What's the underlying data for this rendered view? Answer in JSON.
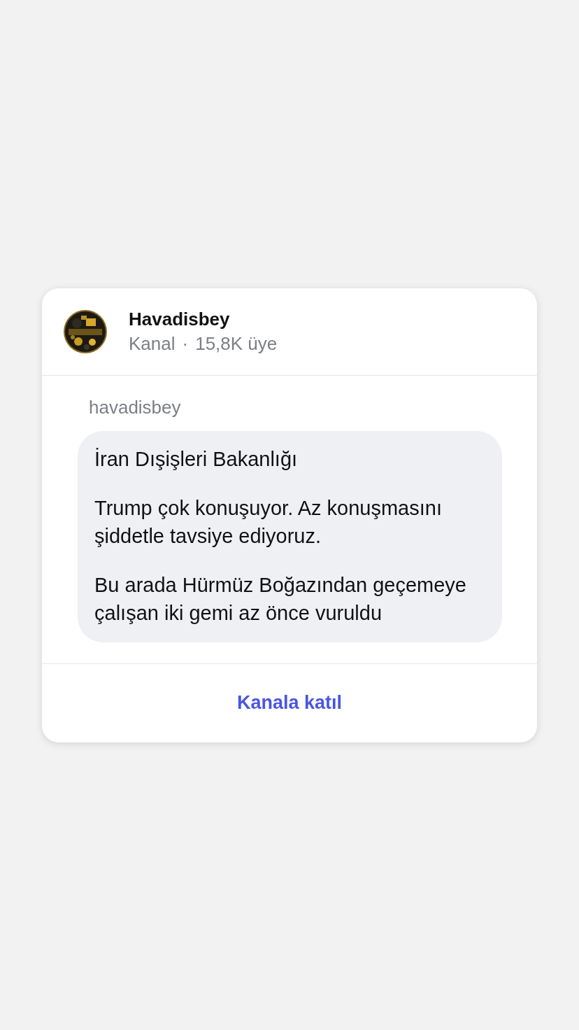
{
  "channel": {
    "name": "Havadisbey",
    "type": "Kanal",
    "separator": "·",
    "members": "15,8K üye"
  },
  "message": {
    "sender": "havadisbey",
    "paragraphs": [
      "İran Dışişleri Bakanlığı",
      "Trump çok konuşuyor. Az konuşmasını şiddetle tavsiye ediyoruz.",
      "Bu arada Hürmüz Boğazından geçemeye çalışan iki gemi az önce vuruldu"
    ]
  },
  "join_button": {
    "label": "Kanala katıl"
  }
}
